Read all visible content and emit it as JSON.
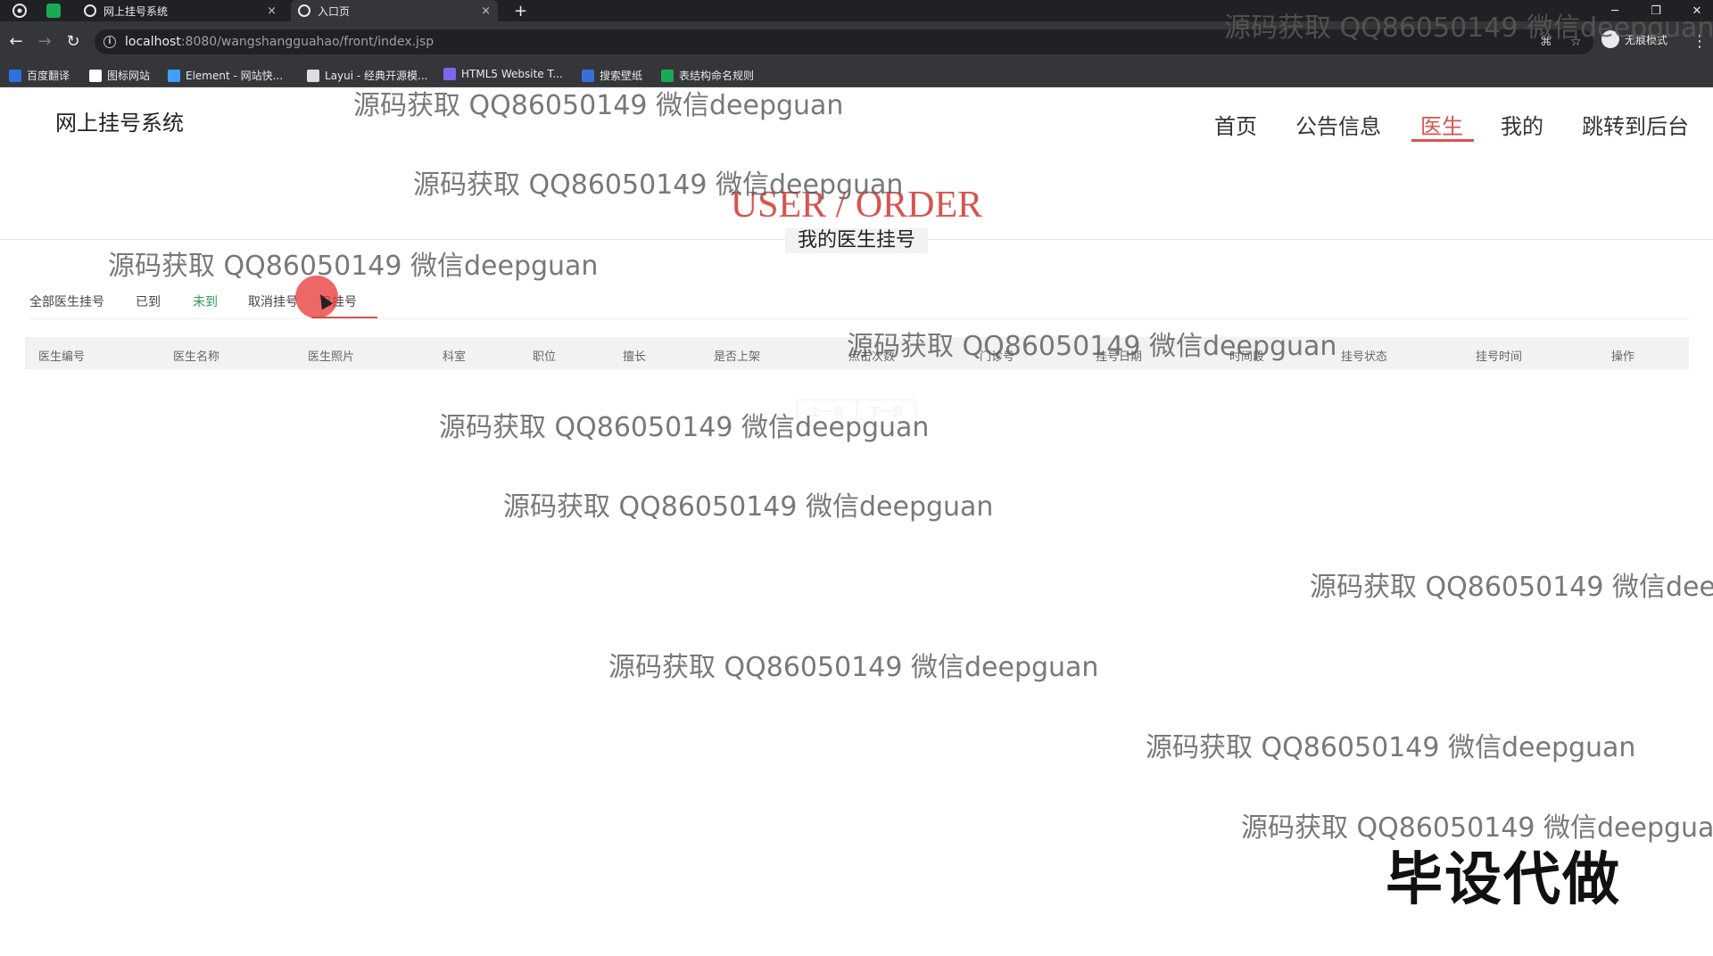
{
  "browser": {
    "tabs": [
      {
        "title": "网上挂号系统"
      },
      {
        "title": "入口页"
      }
    ],
    "new_tab_label": "+",
    "close_label": "×",
    "url_host": "localhost",
    "url_path": ":8080/wangshangguahao/front/index.jsp",
    "incognito_label": "无痕模式",
    "bookmarks": [
      {
        "label": "百度翻译",
        "color": "#2f6fe4"
      },
      {
        "label": "图标网站",
        "color": "#ffffff"
      },
      {
        "label": "Element - 网站快...",
        "color": "#409eff"
      },
      {
        "label": "Layui - 经典开源模...",
        "color": "#dddddd"
      },
      {
        "label": "HTML5 Website T...",
        "color": "#7b68ee"
      },
      {
        "label": "搜索壁纸",
        "color": "#3b6fd8"
      },
      {
        "label": "表结构命名规则",
        "color": "#1aaa55"
      }
    ]
  },
  "site": {
    "title": "网上挂号系统",
    "nav": [
      "首页",
      "公告信息",
      "医生",
      "我的",
      "跳转到后台"
    ],
    "active_nav": "医生",
    "accent_color": "#d9534f"
  },
  "section": {
    "title": "USER / ORDER",
    "subtitle": "我的医生挂号"
  },
  "subtabs": [
    "全部医生挂号",
    "已到",
    "未到",
    "取消挂号",
    "已挂号"
  ],
  "table": {
    "columns": [
      "医生编号",
      "医生名称",
      "医生照片",
      "科室",
      "职位",
      "擅长",
      "是否上架",
      "点击次数",
      "门诊号",
      "挂号日期",
      "时间段",
      "挂号状态",
      "挂号时间",
      "操作"
    ],
    "rows": []
  },
  "pager": {
    "prev": "上一页",
    "next": "下一页"
  },
  "watermark_text": "源码获取 QQ86050149 微信deepguan",
  "stamp_text": "毕设代做"
}
